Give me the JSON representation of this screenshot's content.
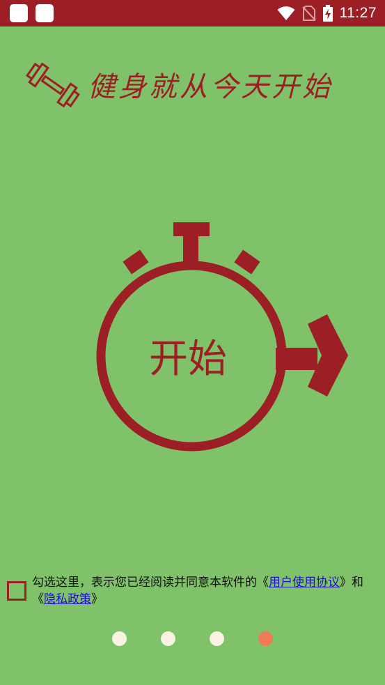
{
  "status_bar": {
    "time": "11:27",
    "icons": [
      "app-icon",
      "app-icon",
      "wifi-icon",
      "no-sim-icon",
      "battery-charging-icon"
    ]
  },
  "header": {
    "title": "健身就从今天开始",
    "icon": "dumbbell-icon"
  },
  "start": {
    "label": "开始",
    "icon": "stopwatch-arrow-icon"
  },
  "consent": {
    "text_before": "勾选这里，表示您已经阅读并同意本软件的《",
    "user_agreement": "用户使用协议",
    "text_middle": "》和《",
    "privacy_policy": "隐私政策",
    "text_after": "》",
    "checked": false
  },
  "pager": {
    "count": 4,
    "active_index": 3
  },
  "colors": {
    "background": "#80c26a",
    "primary": "#9b1f24",
    "link": "#1b10c8",
    "dot": "#faf3e3",
    "dot_active": "#f07a55"
  }
}
